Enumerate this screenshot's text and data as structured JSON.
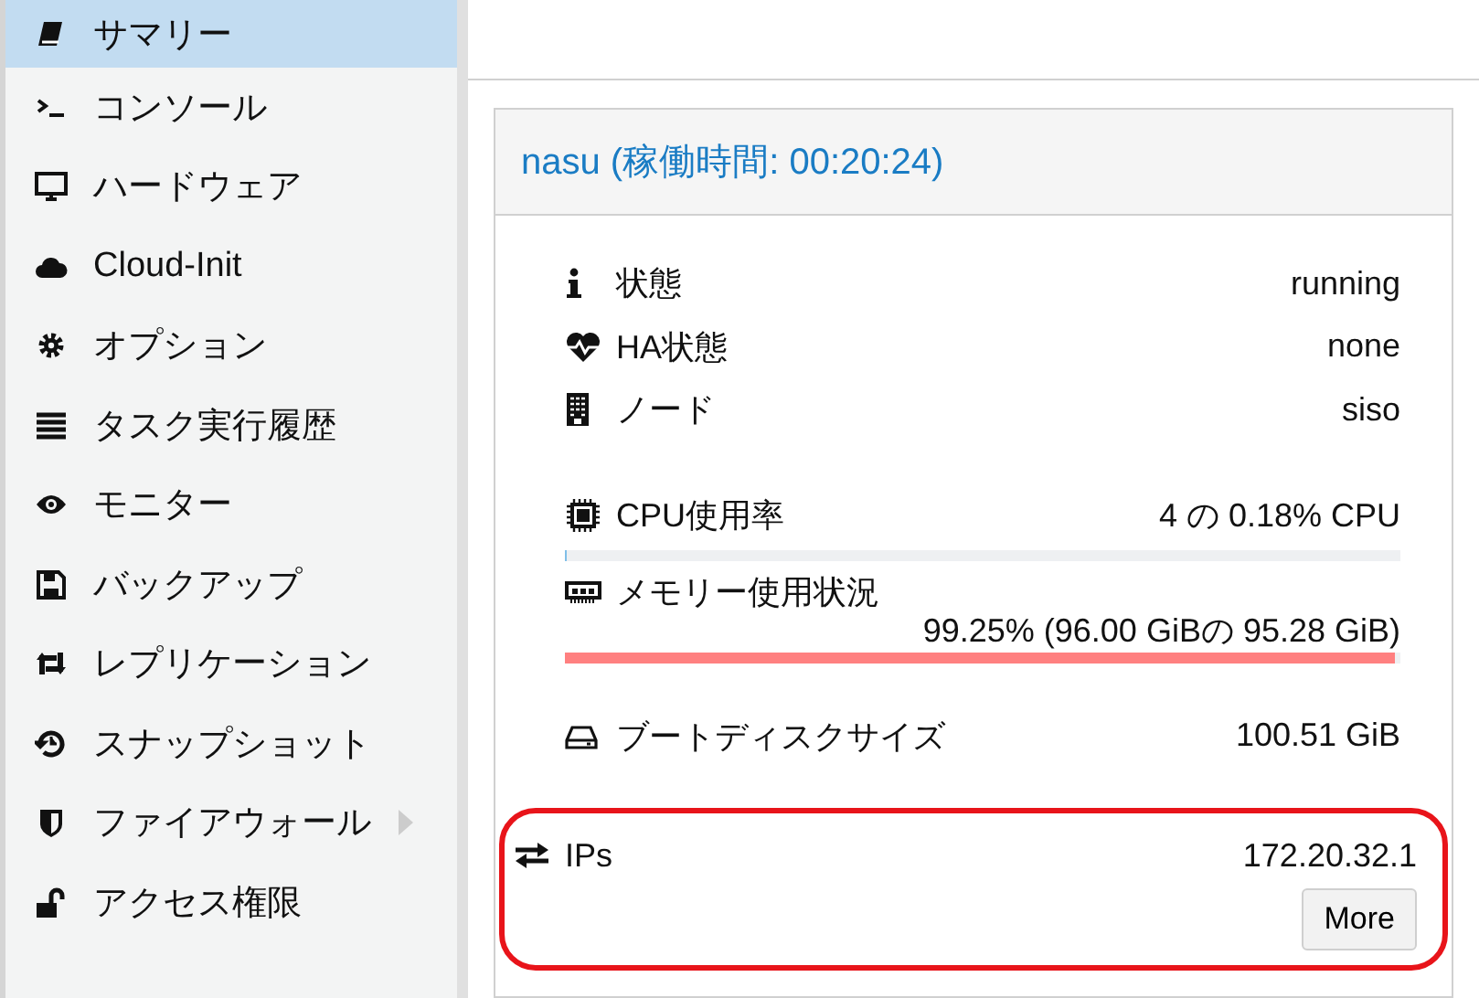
{
  "sidebar": {
    "items": [
      {
        "label": "サマリー",
        "selected": true,
        "has_submenu": false
      },
      {
        "label": "コンソール",
        "selected": false,
        "has_submenu": false
      },
      {
        "label": "ハードウェア",
        "selected": false,
        "has_submenu": false
      },
      {
        "label": "Cloud-Init",
        "selected": false,
        "has_submenu": false
      },
      {
        "label": "オプション",
        "selected": false,
        "has_submenu": false
      },
      {
        "label": "タスク実行履歴",
        "selected": false,
        "has_submenu": false
      },
      {
        "label": "モニター",
        "selected": false,
        "has_submenu": false
      },
      {
        "label": "バックアップ",
        "selected": false,
        "has_submenu": false
      },
      {
        "label": "レプリケーション",
        "selected": false,
        "has_submenu": false
      },
      {
        "label": "スナップショット",
        "selected": false,
        "has_submenu": false
      },
      {
        "label": "ファイアウォール",
        "selected": false,
        "has_submenu": true
      },
      {
        "label": "アクセス権限",
        "selected": false,
        "has_submenu": false
      }
    ]
  },
  "panel": {
    "title": "nasu (稼働時間: 00:20:24)",
    "rows": [
      {
        "kind": "text",
        "label": "状態",
        "value": "running"
      },
      {
        "kind": "text",
        "label": "HA状態",
        "value": "none"
      },
      {
        "kind": "text",
        "label": "ノード",
        "value": "siso"
      },
      {
        "kind": "meter",
        "label": "CPU使用率",
        "value": "4 の 0.18% CPU",
        "level": 0.0018
      },
      {
        "kind": "meter",
        "label": "メモリー使用状況",
        "value": "99.25% (96.00 GiBの 95.28 GiB)",
        "level": 0.9925
      },
      {
        "kind": "text",
        "label": "ブートディスクサイズ",
        "value": "100.51 GiB"
      },
      {
        "kind": "ips",
        "label": "IPs",
        "value": "172.20.32.1",
        "button": "More",
        "highlighted": true
      }
    ]
  }
}
